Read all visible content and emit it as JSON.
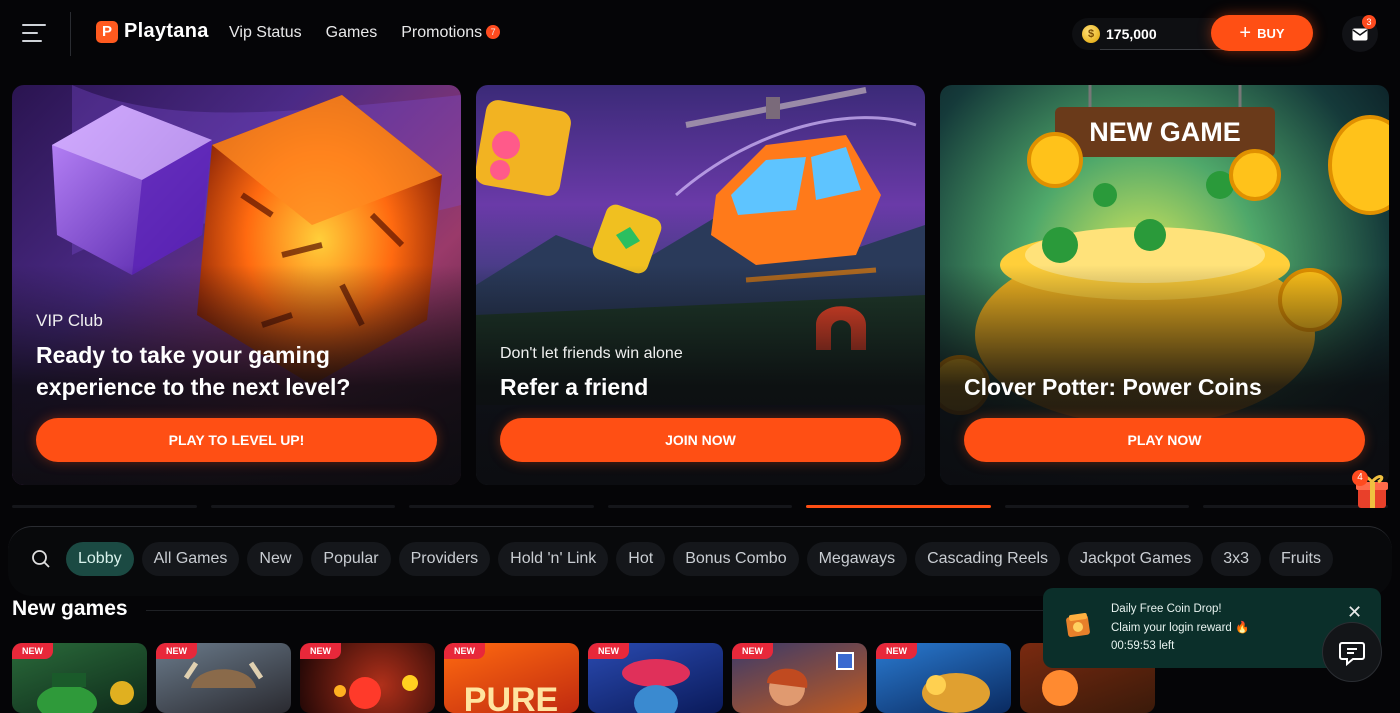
{
  "header": {
    "logo": "Playtana",
    "logo_mark": "P",
    "nav": [
      {
        "label": "Vip Status"
      },
      {
        "label": "Games"
      },
      {
        "label": "Promotions",
        "badge": "7"
      }
    ],
    "coins": "175,000",
    "buy_label": "BUY",
    "mail_badge": "3"
  },
  "banners": [
    {
      "subtitle": "VIP Club",
      "title": "Ready to take your gaming experience to the next level?",
      "button": "PLAY TO LEVEL UP!"
    },
    {
      "subtitle": "Don't let friends win alone",
      "title": "Refer a friend",
      "button": "JOIN NOW"
    },
    {
      "sign": "NEW GAME",
      "title": "Clover Potter: Power Coins",
      "button": "PLAY NOW"
    }
  ],
  "gift_badge": "4",
  "carousel": {
    "active_index": 4
  },
  "filters": [
    "Lobby",
    "All Games",
    "New",
    "Popular",
    "Providers",
    "Hold 'n' Link",
    "Hot",
    "Bonus Combo",
    "Megaways",
    "Cascading Reels",
    "Jackpot Games",
    "3x3",
    "Fruits"
  ],
  "section": {
    "title": "New games"
  },
  "games": [
    {
      "badge": "NEW"
    },
    {
      "badge": "NEW"
    },
    {
      "badge": "NEW"
    },
    {
      "badge": "NEW",
      "art": "PURE"
    },
    {
      "badge": "NEW"
    },
    {
      "badge": "NEW"
    },
    {
      "badge": "NEW"
    },
    {
      "badge": ""
    }
  ],
  "toast": {
    "line1": "Daily Free Coin Drop!",
    "line2": "Claim your login reward 🔥",
    "line3": "00:59:53 left"
  },
  "colors": {
    "accent": "#ff4f14",
    "active_chip": "#1b4a43",
    "toast_bg": "#0b2f2a"
  }
}
